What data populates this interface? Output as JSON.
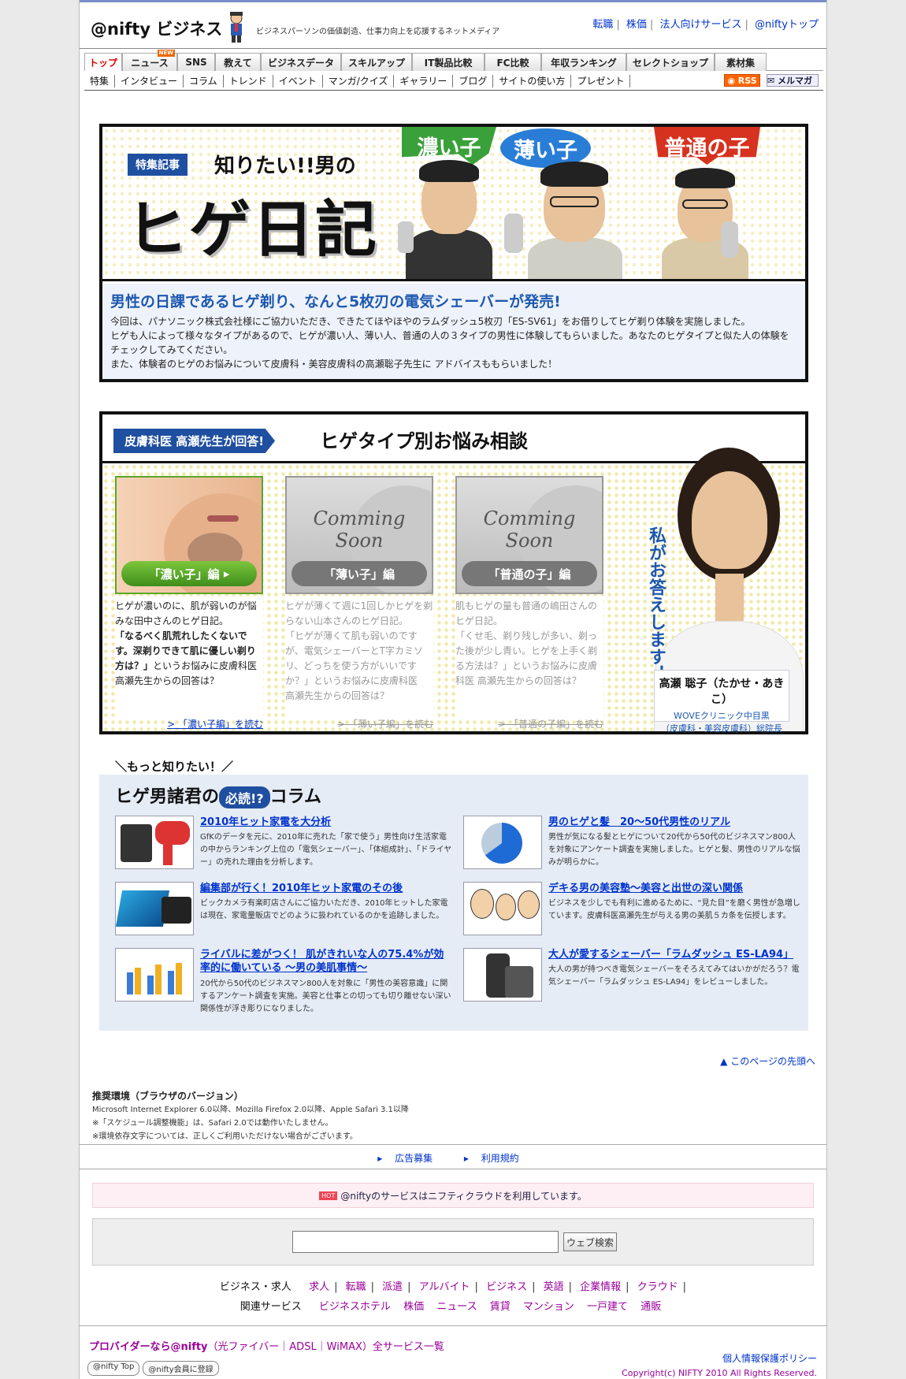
{
  "header": {
    "logo": "@nifty ビジネス",
    "tagline": "ビジネスパーソンの価値創造、仕事力向上を応援するネットメディア",
    "links": [
      "転職",
      "株価",
      "法人向けサービス",
      "@niftyトップ"
    ]
  },
  "nav_main": [
    {
      "label": "トップ",
      "active": true
    },
    {
      "label": "ニュース",
      "badge": "NEW"
    },
    {
      "label": "SNS"
    },
    {
      "label": "教えて"
    },
    {
      "label": "ビジネスデータ"
    },
    {
      "label": "スキルアップ"
    },
    {
      "label": "IT製品比較"
    },
    {
      "label": "FC比較"
    },
    {
      "label": "年収ランキング"
    },
    {
      "label": "セレクトショップ"
    },
    {
      "label": "素材集"
    }
  ],
  "nav_sub": [
    "特集",
    "インタビュー",
    "コラム",
    "トレンド",
    "イベント",
    "マンガ/クイズ",
    "ギャラリー",
    "ブログ",
    "サイトの使い方",
    "プレゼント"
  ],
  "feeds": {
    "rss": "RSS",
    "mail": "メルマガ"
  },
  "feature": {
    "badge": "特集記事",
    "title_small": "知りたい!!男の",
    "title_big": "ヒゲ日記",
    "bubbles": [
      "濃い子",
      "薄い子",
      "普通の子"
    ],
    "headline": "男性の日課であるヒゲ剃り、なんと5枚刃の電気シェーバーが発売!",
    "paragraphs": [
      "今回は、パナソニック株式会社様にご協力いただき、できたてほやほやのラムダッシュ5枚刃「ES-SV61」をお借りしてヒゲ剃り体験を実施しました。",
      "ヒゲも人によって様々なタイプがあるので、ヒゲが濃い人、薄い人、普通の人の３タイプの男性に体験してもらいました。あなたのヒゲタイプと似た人の体験をチェックしてみてください。",
      "また、体験者のヒゲのお悩みについて皮膚科・美容皮膚科の高瀬聡子先生に アドバイスももらいました！"
    ]
  },
  "consult": {
    "badge": "皮膚科医 高瀬先生が回答!",
    "title": "ヒゲタイプ別お悩み相談",
    "cards": [
      {
        "label": "「濃い子」編",
        "soon": "",
        "text": "ヒゲが濃いのに、肌が弱いのが悩みな田中さんのヒゲ日記。",
        "quote": "「なるべく肌荒れしたくないです。深剃りできて肌に優しい剃り方は？」",
        "text2": "というお悩みに皮膚科医 高瀬先生からの回答は？",
        "link": "「濃い子編」を読む"
      },
      {
        "label": "「薄い子」編",
        "soon": "Comming Soon",
        "text": "ヒゲが薄くて週に1回しかヒゲを剃らない山本さんのヒゲ日記。",
        "quote": "「ヒゲが薄くて肌も弱いのですが、電気シェーバーとT字カミソリ、どっちを使う方がいいですか？」",
        "text2": "というお悩みに皮膚科医　高瀬先生からの回答は？",
        "link": "「薄い子編」を読む"
      },
      {
        "label": "「普通の子」編",
        "soon": "Comming Soon",
        "text": "肌もヒゲの量も普通の嶋田さんのヒゲ日記。",
        "quote": "「くせ毛、剃り残しが多い、剃った後が少し青い。ヒゲを上手く剃る方法は？」",
        "text2": "というお悩みに皮膚科医 高瀬先生からの回答は？",
        "link": "「普通の子編」を読む"
      }
    ],
    "doctor_vertical": "私がお答えします！",
    "doctor_name": "高瀬 聡子（たかせ・あきこ）",
    "doctor_clinic": "WOVEクリニック中目黒",
    "doctor_title": "（皮膚科・美容皮膚科）総院長"
  },
  "columns": {
    "kicker": "＼もっと知りたい！／",
    "title_a": "ヒゲ男諸君の",
    "title_hot": "必読!?",
    "title_b": "コラム",
    "items": [
      {
        "title": "2010年ヒット家電を大分析",
        "desc": "GfKのデータを元に、2010年に売れた「家で使う」男性向け生活家電の中からランキング上位の「電気シェーバー」、「体組成計」、「ドライヤー」の売れた理由を分析します。"
      },
      {
        "title": "男のヒゲと髪　20〜50代男性のリアル",
        "desc": "男性が気になる髪とヒゲについて20代から50代のビジネスマン800人を対象にアンケート調査を実施しました。ヒゲと髪、男性のリアルな悩みが明らかに。"
      },
      {
        "title": "編集部が行く！2010年ヒット家電のその後",
        "desc": "ビックカメラ有楽町店さんにご協力いただき、2010年ヒットした家電は現在、家電量販店でどのように扱われているのかを追跡しました。"
      },
      {
        "title": "デキる男の美容塾〜美容と出世の深い関係",
        "desc": "ビジネスを少しでも有利に進めるために、“見た目”を磨く男性が急増しています。皮膚科医高瀬先生が与える男の美肌５カ条を伝授します。"
      },
      {
        "title": "ライバルに差がつく！ 肌がきれいな人の75.4%が効率的に働いている 〜男の美肌事情〜",
        "desc": "20代から50代のビジネスマン800人を対象に「男性の美容意識」に関するアンケート調査を実施。美容と仕事との切っても切り離せない深い関係性が浮き彫りになりました。"
      },
      {
        "title": "大人が愛するシェーバー「ラムダッシュ ES-LA94」",
        "desc": "大人の男が持つべき電気シェーバーをそろえてみてはいかがだろう？電気シェーバー「ラムダッシュ ES-LA94」をレビューしました。"
      }
    ]
  },
  "pagetop": "このページの先頭へ",
  "env": {
    "title": "推奨環境（ブラウザのバージョン）",
    "lines": [
      "Microsoft Internet Explorer 6.0以降、Mozilla Firefox 2.0以降、Apple Safari 3.1以降",
      "※「スケジュール調整機能」は、Safari 2.0では動作いたしません。",
      "※環境依存文字については、正しくご利用いただけない場合がございます。"
    ]
  },
  "footer_links": [
    "広告募集",
    "利用規約"
  ],
  "cloud": {
    "badge": "HOT",
    "text": "@niftyのサービスはニフティクラウドを利用しています。"
  },
  "search": {
    "button": "ウェブ検索",
    "value": ""
  },
  "footer_row1": {
    "label": "ビジネス・求人",
    "links": [
      "求人",
      "転職",
      "派遣",
      "アルバイト",
      "ビジネス",
      "英語",
      "企業情報",
      "クラウド"
    ]
  },
  "footer_row2": {
    "label": "関連サービス",
    "links": [
      "ビジネスホテル",
      "株価",
      "ニュース",
      "賃貸",
      "マンション",
      "一戸建て",
      "通販"
    ]
  },
  "provider": {
    "lead": "プロバイダーなら@nifty",
    "links": "（光ファイバー｜ADSL｜WiMAX）全サービス一覧"
  },
  "privacy": "個人情報保護ポリシー",
  "bottom_buttons": [
    "@nifty Top",
    "@nifty会員に登録"
  ],
  "copyright": "Copyright(c) NIFTY 2010 All Rights Reserved."
}
